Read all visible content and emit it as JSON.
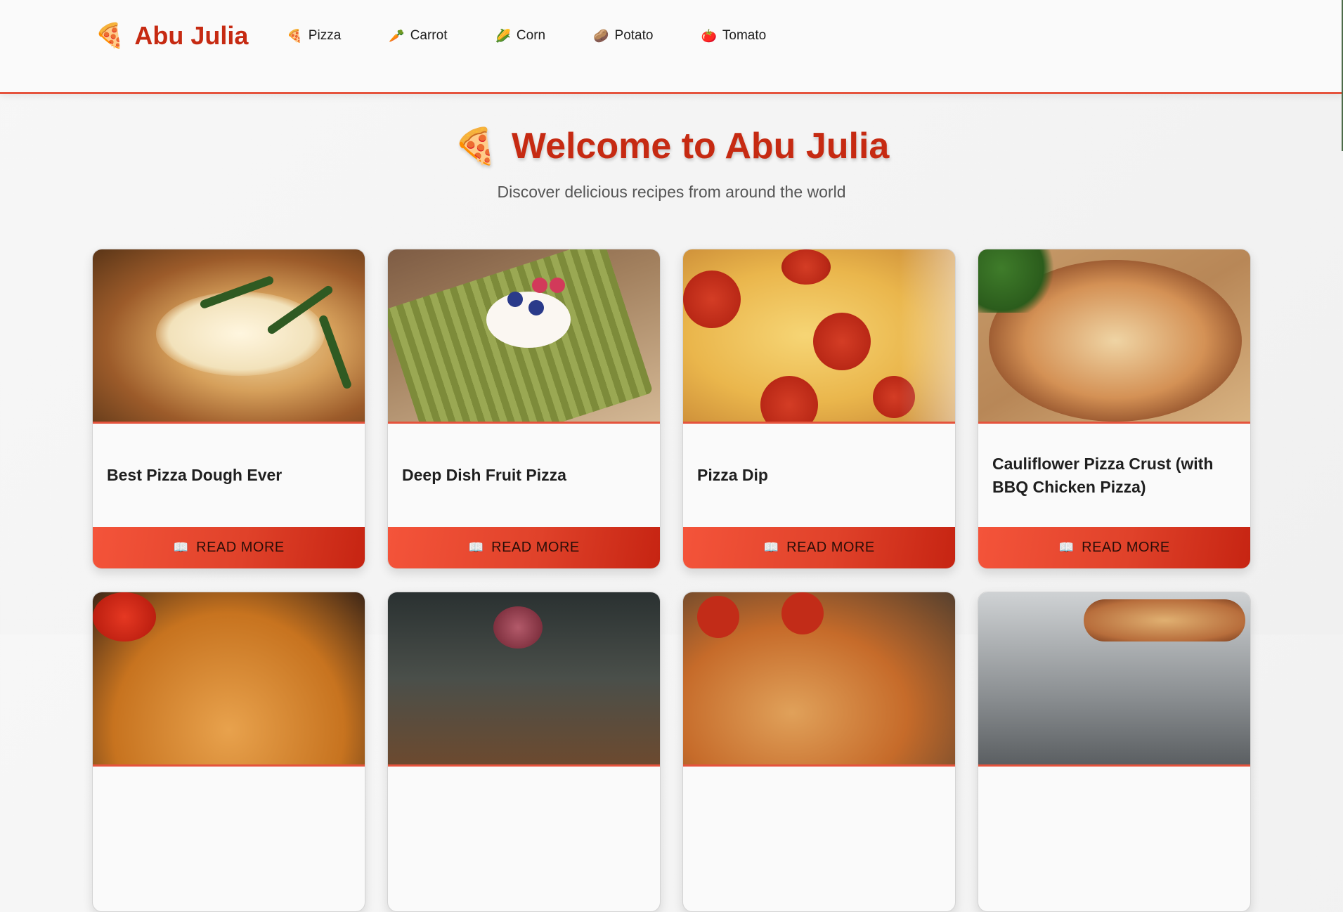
{
  "brand": {
    "name": "Abu Julia",
    "icon": "pizza-icon"
  },
  "nav": [
    {
      "label": "Pizza",
      "icon": "pizza-icon",
      "glyph": "🍕"
    },
    {
      "label": "Carrot",
      "icon": "carrot-icon",
      "glyph": "🥕"
    },
    {
      "label": "Corn",
      "icon": "corn-icon",
      "glyph": "🌽"
    },
    {
      "label": "Potato",
      "icon": "potato-icon",
      "glyph": "🥔"
    },
    {
      "label": "Tomato",
      "icon": "tomato-icon",
      "glyph": "🍅"
    }
  ],
  "hero": {
    "title": "Welcome to Abu Julia",
    "subtitle": "Discover delicious recipes from around the world"
  },
  "cards": [
    {
      "title": "Best Pizza Dough Ever",
      "button": "READ MORE"
    },
    {
      "title": "Deep Dish Fruit Pizza",
      "button": "READ MORE"
    },
    {
      "title": "Pizza Dip",
      "button": "READ MORE"
    },
    {
      "title": "Cauliflower Pizza Crust (with BBQ Chicken Pizza)",
      "button": "READ MORE"
    }
  ],
  "colors": {
    "accent": "#e5533d",
    "brand": "#c62a12",
    "button_gradient_start": "#f4543a",
    "button_gradient_end": "#c62412"
  }
}
